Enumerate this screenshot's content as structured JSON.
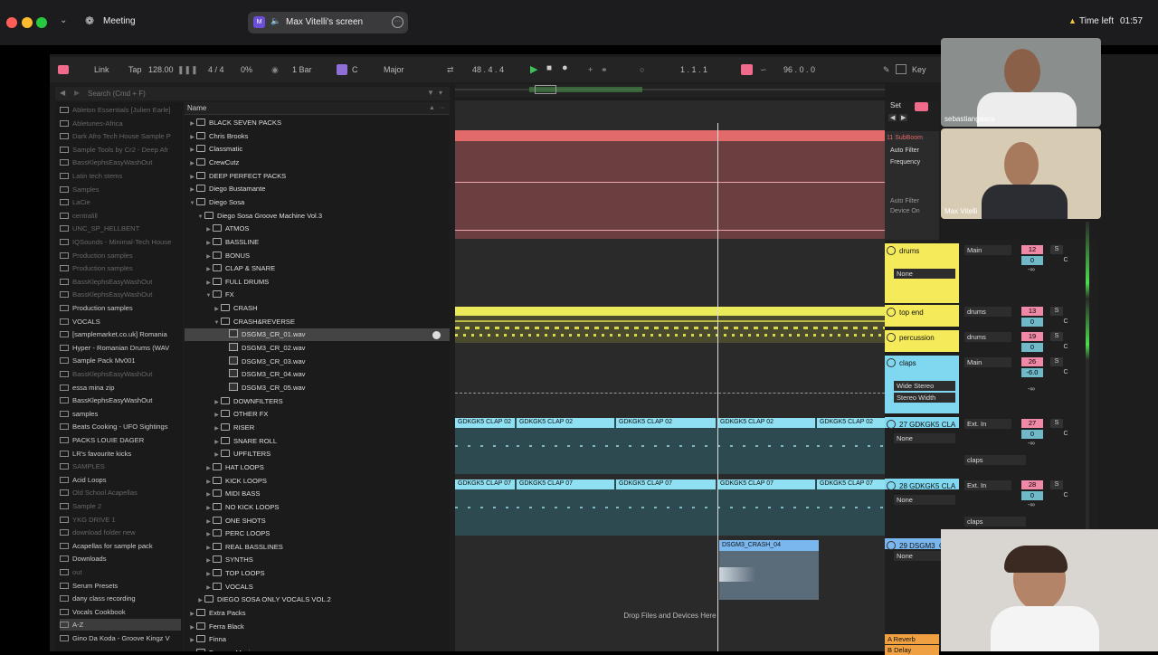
{
  "zoom": {
    "meeting_label": "Meeting",
    "share_label": "Max Vitelli's screen",
    "time_left_label": "Time left",
    "time_left_value": "01:57",
    "participants": [
      "sebastiangasca",
      "Max Vitelli"
    ]
  },
  "transport": {
    "link": "Link",
    "tap": "Tap",
    "tempo": "128.00",
    "meter": "4 / 4",
    "swing": "0%",
    "quantize": "1 Bar",
    "key": "C",
    "scale": "Major",
    "position": "48 .  4 .  4",
    "loop_start": "1 .  1 .  1",
    "loop_length": "96 .  0 .  0",
    "key_mode": "Key"
  },
  "browser": {
    "search_placeholder": "Search (Cmd + F)",
    "column_name": "Name",
    "places": [
      {
        "label": "Ableton Essentials [Julien Earle]",
        "dim": true
      },
      {
        "label": "Abletunes-Africa",
        "dim": true
      },
      {
        "label": "Dark Afro Tech House Sample P",
        "dim": true
      },
      {
        "label": "Sample Tools by Cr2 - Deep Afr",
        "dim": true
      },
      {
        "label": "BassKlephsEasyWashOut",
        "dim": true
      },
      {
        "label": "Latin tech stems",
        "dim": true
      },
      {
        "label": "Samples",
        "dim": true
      },
      {
        "label": "LaCie",
        "dim": true
      },
      {
        "label": "centralill",
        "dim": true
      },
      {
        "label": "UNC_SP_HELLBENT",
        "dim": true
      },
      {
        "label": "IQSounds - Minimal-Tech House",
        "dim": true
      },
      {
        "label": "Production samples",
        "dim": true
      },
      {
        "label": "Production samples",
        "dim": true
      },
      {
        "label": "BassKlephsEasyWashOut",
        "dim": true
      },
      {
        "label": "BassKlephsEasyWashOut",
        "dim": true
      },
      {
        "label": "Production samples",
        "dim": false
      },
      {
        "label": "VOCALS",
        "dim": false
      },
      {
        "label": "[samplemarket.co.uk] Romania",
        "dim": false
      },
      {
        "label": "Hyper - Romanian Drums (WAV",
        "dim": false
      },
      {
        "label": "Sample Pack Mv001",
        "dim": false
      },
      {
        "label": "BassKlephsEasyWashOut",
        "dim": true
      },
      {
        "label": "essa mina zip",
        "dim": false
      },
      {
        "label": "BassKlephsEasyWashOut",
        "dim": false
      },
      {
        "label": "samples",
        "dim": false
      },
      {
        "label": "Beats Cooking - UFO Sightings",
        "dim": false
      },
      {
        "label": "PACKS LOUIE DAGER",
        "dim": false
      },
      {
        "label": "LR's favourite kicks",
        "dim": false
      },
      {
        "label": "SAMPLES",
        "dim": true
      },
      {
        "label": "Acid Loops",
        "dim": false
      },
      {
        "label": "Old School Acapellas",
        "dim": true
      },
      {
        "label": "Sample 2",
        "dim": true
      },
      {
        "label": "YKG DRIVE 1",
        "dim": true
      },
      {
        "label": "download folder new",
        "dim": true
      },
      {
        "label": "Acapellas for sample pack",
        "dim": false
      },
      {
        "label": "Downloads",
        "dim": false
      },
      {
        "label": "out",
        "dim": true
      },
      {
        "label": "Serum Presets",
        "dim": false
      },
      {
        "label": "dany class recording",
        "dim": false
      },
      {
        "label": "Vocals Cookbook",
        "dim": false
      },
      {
        "label": "A-Z",
        "dim": false
      },
      {
        "label": "Gino Da Koda - Groove Kingz V",
        "dim": false
      }
    ],
    "items": [
      {
        "label": "BLACK SEVEN PACKS",
        "depth": 0,
        "type": "folder",
        "open": false
      },
      {
        "label": "Chris Brooks",
        "depth": 0,
        "type": "folder",
        "open": false
      },
      {
        "label": "Classmatic",
        "depth": 0,
        "type": "folder",
        "open": false
      },
      {
        "label": "CrewCutz",
        "depth": 0,
        "type": "folder",
        "open": false
      },
      {
        "label": "DEEP PERFECT PACKS",
        "depth": 0,
        "type": "folder",
        "open": false
      },
      {
        "label": "Diego Bustamante",
        "depth": 0,
        "type": "folder",
        "open": false
      },
      {
        "label": "Diego Sosa",
        "depth": 0,
        "type": "folder",
        "open": true
      },
      {
        "label": "Diego Sosa Groove Machine Vol.3",
        "depth": 1,
        "type": "folder",
        "open": true
      },
      {
        "label": "ATMOS",
        "depth": 2,
        "type": "folder",
        "open": false
      },
      {
        "label": "BASSLINE",
        "depth": 2,
        "type": "folder",
        "open": false
      },
      {
        "label": "BONUS",
        "depth": 2,
        "type": "folder",
        "open": false
      },
      {
        "label": "CLAP & SNARE",
        "depth": 2,
        "type": "folder",
        "open": false
      },
      {
        "label": "FULL DRUMS",
        "depth": 2,
        "type": "folder",
        "open": false
      },
      {
        "label": "FX",
        "depth": 2,
        "type": "folder",
        "open": true
      },
      {
        "label": "CRASH",
        "depth": 3,
        "type": "folder",
        "open": false
      },
      {
        "label": "CRASH&REVERSE",
        "depth": 3,
        "type": "folder",
        "open": true
      },
      {
        "label": "DSGM3_CR_01.wav",
        "depth": 4,
        "type": "file",
        "selected": true
      },
      {
        "label": "DSGM3_CR_02.wav",
        "depth": 4,
        "type": "file"
      },
      {
        "label": "DSGM3_CR_03.wav",
        "depth": 4,
        "type": "file"
      },
      {
        "label": "DSGM3_CR_04.wav",
        "depth": 4,
        "type": "file"
      },
      {
        "label": "DSGM3_CR_05.wav",
        "depth": 4,
        "type": "file"
      },
      {
        "label": "DOWNFILTERS",
        "depth": 3,
        "type": "folder",
        "open": false
      },
      {
        "label": "OTHER FX",
        "depth": 3,
        "type": "folder",
        "open": false
      },
      {
        "label": "RISER",
        "depth": 3,
        "type": "folder",
        "open": false
      },
      {
        "label": "SNARE ROLL",
        "depth": 3,
        "type": "folder",
        "open": false
      },
      {
        "label": "UPFILTERS",
        "depth": 3,
        "type": "folder",
        "open": false
      },
      {
        "label": "HAT LOOPS",
        "depth": 2,
        "type": "folder",
        "open": false
      },
      {
        "label": "KICK LOOPS",
        "depth": 2,
        "type": "folder",
        "open": false
      },
      {
        "label": "MIDI BASS",
        "depth": 2,
        "type": "folder",
        "open": false
      },
      {
        "label": "NO KICK LOOPS",
        "depth": 2,
        "type": "folder",
        "open": false
      },
      {
        "label": "ONE SHOTS",
        "depth": 2,
        "type": "folder",
        "open": false
      },
      {
        "label": "PERC LOOPS",
        "depth": 2,
        "type": "folder",
        "open": false
      },
      {
        "label": "REAL BASSLINES",
        "depth": 2,
        "type": "folder",
        "open": false
      },
      {
        "label": "SYNTHS",
        "depth": 2,
        "type": "folder",
        "open": false
      },
      {
        "label": "TOP LOOPS",
        "depth": 2,
        "type": "folder",
        "open": false
      },
      {
        "label": "VOCALS",
        "depth": 2,
        "type": "folder",
        "open": false
      },
      {
        "label": "DIEGO SOSA ONLY VOCALS VOL.2",
        "depth": 1,
        "type": "folder",
        "open": false
      },
      {
        "label": "Extra Packs",
        "depth": 0,
        "type": "folder",
        "open": false
      },
      {
        "label": "Ferra Black",
        "depth": 0,
        "type": "folder",
        "open": false
      },
      {
        "label": "Finna",
        "depth": 0,
        "type": "folder",
        "open": false
      },
      {
        "label": "Freenzy Music",
        "depth": 0,
        "type": "folder",
        "open": false
      }
    ]
  },
  "arrangement": {
    "bar_numbers": [
      "44",
      "45",
      "46",
      "47",
      "48",
      "49",
      "50",
      "51",
      "52"
    ],
    "set_label": "Set",
    "drop_hint": "Drop Files and Devices Here",
    "clap_clip_02": "GDKGK5 CLAP 02",
    "clap_clip_07": "GDKGK5 CLAP 07",
    "crash_clip": "DSGM3_CRASH_04"
  },
  "devices": {
    "track11_name": "11 SubBoom",
    "auto_filter": "Auto Filter",
    "frequency": "Frequency",
    "auto_filter_device": "Auto Filter Device On"
  },
  "mixer": {
    "tracks": [
      {
        "name": "drums",
        "route": "Main",
        "vol": "12",
        "pan": "0",
        "color": "#f5ea5a"
      },
      {
        "name": "top end",
        "route": "drums",
        "vol": "13",
        "pan": "0",
        "color": "#f5ea5a"
      },
      {
        "name": "percussion",
        "route": "drums",
        "vol": "19",
        "pan": "0",
        "color": "#f5ea5a"
      },
      {
        "name": "claps",
        "route": "Main",
        "vol": "26",
        "pan": "-6.0",
        "color": "#7fd8f0"
      },
      {
        "name": "27 GDKGK5 CLA",
        "route": "Ext. In",
        "vol": "27",
        "pan": "0",
        "color": "#7fd8f0"
      },
      {
        "name": "28 GDKGK5 CLA",
        "route": "Ext. In",
        "vol": "28",
        "pan": "0",
        "color": "#7fd8f0"
      },
      {
        "name": "29 DSGM3_C",
        "route": "",
        "vol": "",
        "pan": "",
        "color": "#7ab7ef"
      }
    ],
    "none": "None",
    "wide_stereo": "Wide Stereo",
    "stereo_width": "Stereo Width",
    "claps_route": "claps",
    "inf": "-∞",
    "reverb": "A Reverb",
    "delay": "B Delay"
  }
}
